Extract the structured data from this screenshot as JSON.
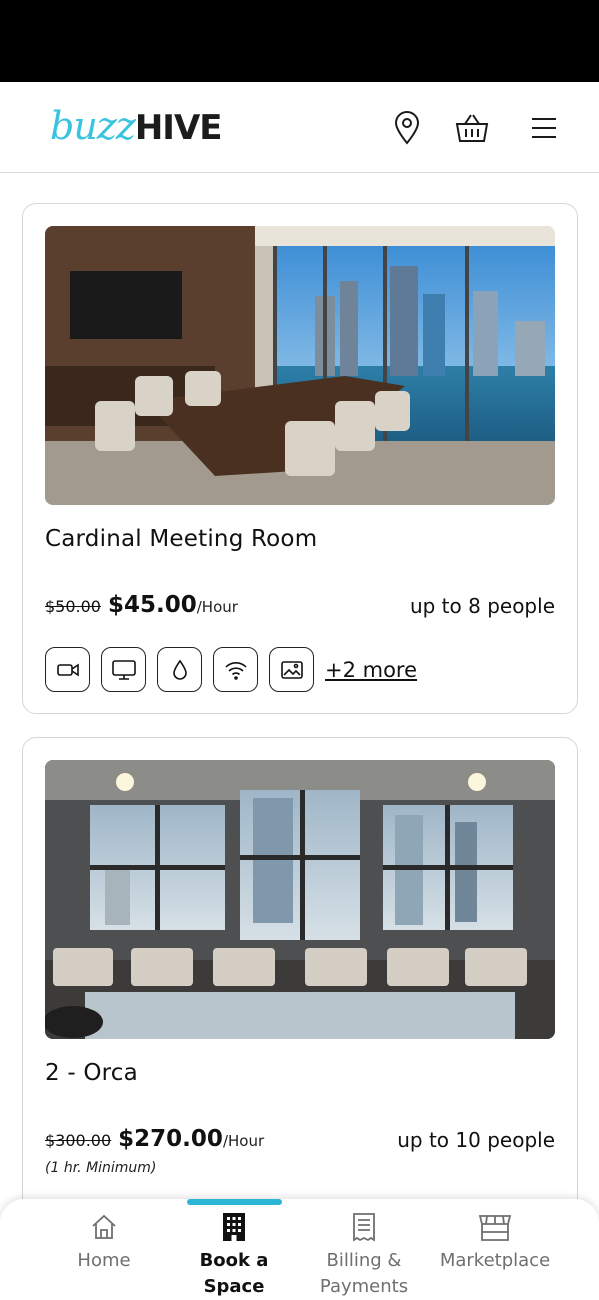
{
  "header": {
    "logo_buzz": "buzz",
    "logo_hive": "HIVE",
    "icons": [
      "location-pin-icon",
      "basket-icon",
      "hamburger-menu-icon"
    ],
    "brand_color": "#39c3df"
  },
  "rooms": [
    {
      "title": "Cardinal Meeting Room",
      "old_price": "$50.00",
      "price": "$45.00",
      "unit": "/Hour",
      "capacity": "up to 8 people",
      "amenities": [
        "video-camera-icon",
        "monitor-icon",
        "water-drop-icon",
        "wifi-icon",
        "picture-icon"
      ],
      "more": "+2 more"
    },
    {
      "title": "2 - Orca",
      "old_price": "$300.00",
      "price": "$270.00",
      "unit": "/Hour",
      "capacity": "up to 10 people",
      "minimum": "(1 hr. Minimum)"
    }
  ],
  "nav": {
    "home": "Home",
    "book_line1": "Book a",
    "book_line2": "Space",
    "billing_line1": "Billing &",
    "billing_line2": "Payments",
    "marketplace": "Marketplace",
    "active": "Book a Space",
    "active_color": "#2bb6d4"
  }
}
